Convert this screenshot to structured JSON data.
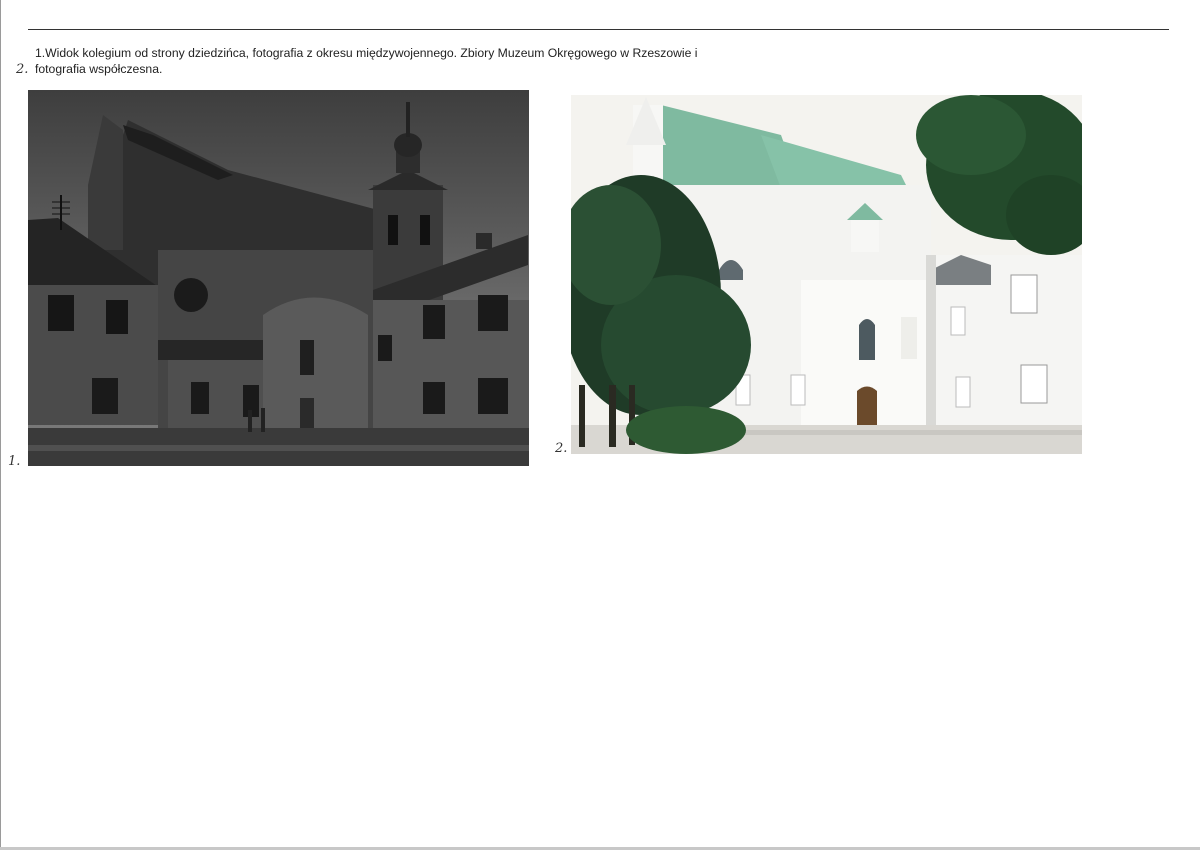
{
  "caption": {
    "line1": "1.Widok kolegium od strony dziedzińca, fotografia z okresu międzywojennego. Zbiory Muzeum Okręgowego w Rzeszowie i",
    "line2": "fotografia współczesna.",
    "handwritten_number": "2."
  },
  "photos": [
    {
      "handwritten_label": "1.",
      "style": "black-and-white",
      "icon": "historic-courtyard-photo"
    },
    {
      "handwritten_label": "2.",
      "style": "color",
      "icon": "modern-courtyard-photo"
    }
  ],
  "colors": {
    "paper": "#ffffff",
    "rule": "#333333",
    "text": "#222222",
    "roof_green": "#7fbaa0",
    "wall_white": "#f3f3f1",
    "tree_dark": "#1f3b27"
  }
}
